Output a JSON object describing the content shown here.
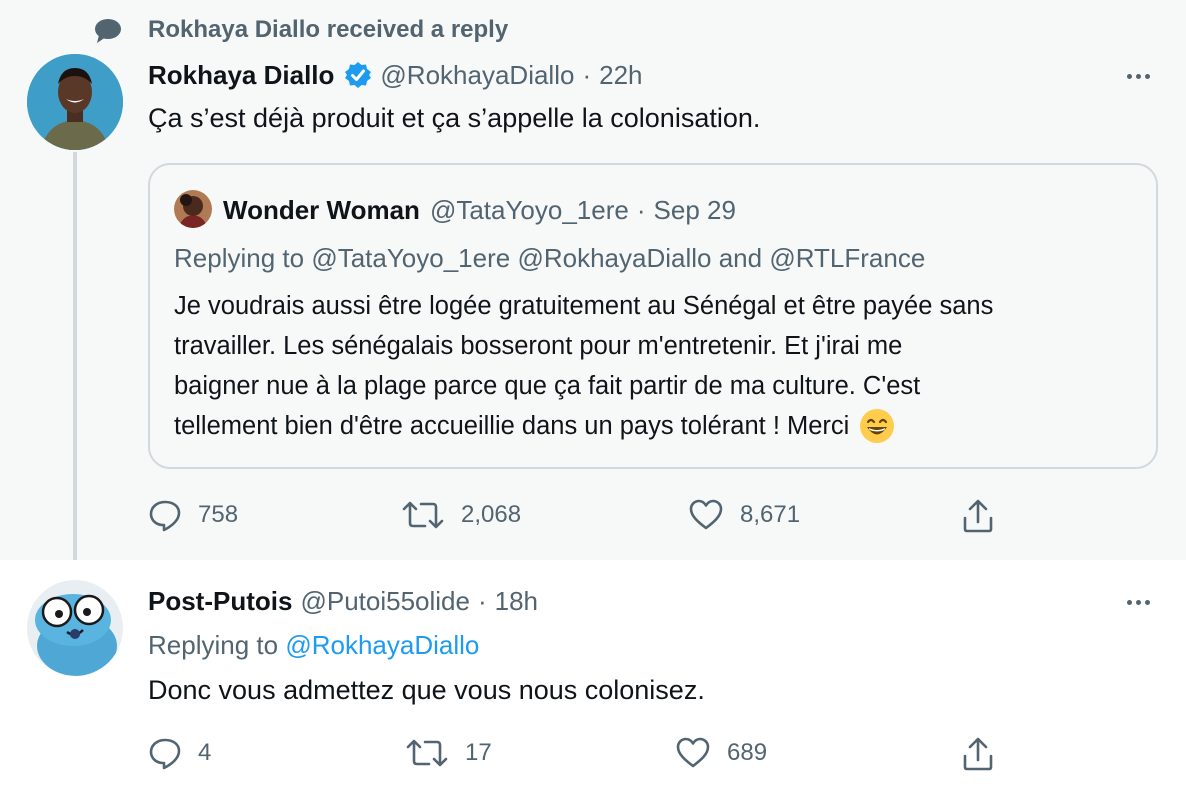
{
  "context": {
    "text": "Rokhaya Diallo received a reply",
    "icon": "speech-bubble-icon"
  },
  "tweet1": {
    "author_name": "Rokhaya Diallo",
    "handle": "@RokhayaDiallo",
    "separator": "·",
    "time": "22h",
    "text": "Ça s’est déjà produit et ça s’appelle la colonisation.",
    "verified": true,
    "quote": {
      "author_name": "Wonder Woman",
      "handle": "@TataYoyo_1ere",
      "separator": "·",
      "date": "Sep 29",
      "replying_prefix": "Replying to",
      "replying_handles": "@TataYoyo_1ere @RokhayaDiallo",
      "replying_and": "and",
      "replying_last": "@RTLFrance",
      "lines": [
        "Je voudrais aussi être logée gratuitement au Sénégal et être payée sans",
        "travailler. Les sénégalais bosseront pour m'entretenir. Et j'irai me",
        "baigner nue à la plage parce que ça fait partir de ma culture. C'est",
        "tellement bien d'être accueillie dans un pays tolérant ! Merci"
      ],
      "emoji": "😄"
    },
    "stats": {
      "replies": "758",
      "retweets": "2,068",
      "likes": "8,671"
    }
  },
  "tweet2": {
    "author_name": "Post-Putois",
    "handle": "@Putoi55olide",
    "separator": "·",
    "time": "18h",
    "replying_prefix": "Replying to",
    "replying_handle": "@RokhayaDiallo",
    "text": "Donc vous admettez que vous nous colonisez.",
    "stats": {
      "replies": "4",
      "retweets": "17",
      "likes": "689"
    }
  },
  "colors": {
    "link": "#1d9bf0",
    "muted": "#536471",
    "text": "#0f1419",
    "verified": "#1d9bf0",
    "highlight_bg": "#f7f9f9"
  }
}
